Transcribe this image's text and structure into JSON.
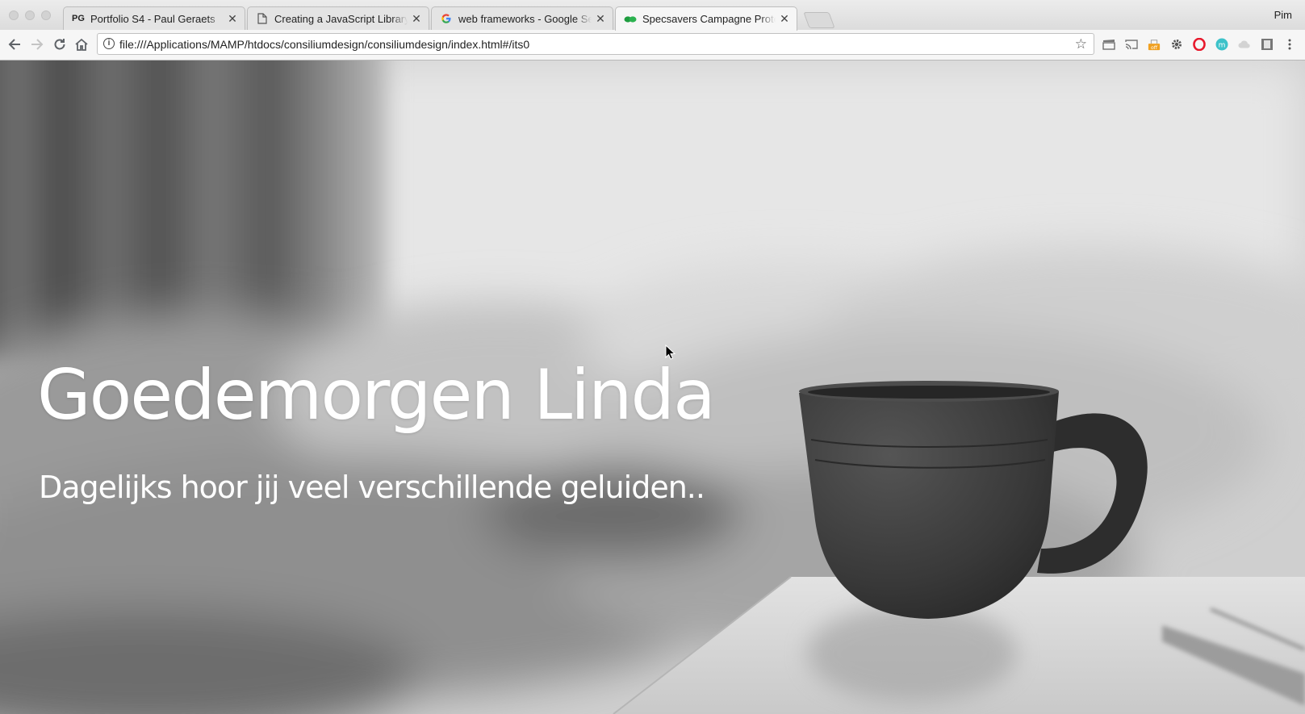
{
  "browser": {
    "profile_name": "Pim",
    "tabs": [
      {
        "title": "Portfolio S4 - Paul Geraets",
        "favicon": "pg-logo-icon",
        "favicon_text": "PG",
        "active": false
      },
      {
        "title": "Creating a JavaScript Library |",
        "favicon": "document-icon",
        "active": false
      },
      {
        "title": "web frameworks - Google Search",
        "favicon": "google-icon",
        "active": false
      },
      {
        "title": "Specsavers Campagne Prototype",
        "favicon": "specsavers-icon",
        "active": true
      }
    ],
    "address_bar": {
      "url": "file:///Applications/MAMP/htdocs/consiliumdesign/consiliumdesign/index.html#/its0"
    },
    "extensions": [
      "clapper-icon",
      "cast-icon",
      "off-badge-icon",
      "gear-icon",
      "opera-icon",
      "m-circle-icon",
      "cloud-icon",
      "film-strip-icon",
      "kebab-menu-icon"
    ],
    "colors": {
      "tabstrip": "#dcdcdc",
      "toolbar": "#f6f6f6",
      "specsavers_green": "#1e9c3f"
    }
  },
  "page": {
    "title": "Goedemorgen Linda",
    "subtitle": "Dagelijks hoor jij veel verschillende geluiden..",
    "background": "black-and-white photo of a coffee mug on a bedside table in front of an unmade bed"
  }
}
